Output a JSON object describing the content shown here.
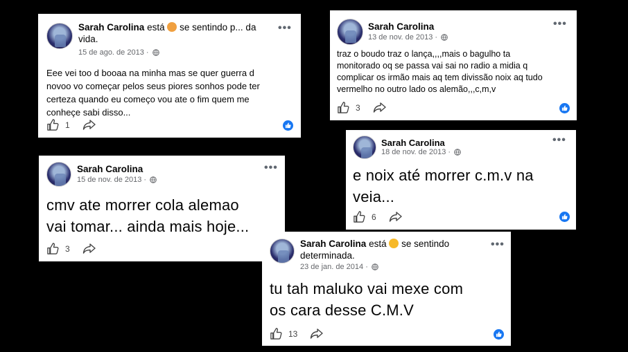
{
  "posts": [
    {
      "author": "Sarah Carolina",
      "status_prefix": "está",
      "feeling_line1": "se sentindo p... da",
      "feeling_line2": "vida.",
      "date": "15 de ago. de 2013 ·",
      "text": [
        "Eee vei too d booaa na minha mas se quer guerra d",
        "novoo vo começar pelos seus piores sonhos pode ter",
        "certeza quando eu começo vou ate o fim quem me",
        "conheçe sabi disso..."
      ],
      "likes": "1",
      "more": "•••"
    },
    {
      "author": "Sarah Carolina",
      "date": "13 de nov. de 2013 ·",
      "text": [
        "traz o boudo traz o lança,,,,mais o bagulho ta",
        "monitorado oq se passa vai sai no radio a midia q",
        "complicar os irmão mais aq tem divissão noix aq tudo",
        "vermelho no outro lado os alemão,,,c,m,v"
      ],
      "likes": "3",
      "more": "•••"
    },
    {
      "author": "Sarah Carolina",
      "date": "18 de nov. de 2013 ·",
      "text": [
        "e noix até morrer c.m.v na",
        "veia..."
      ],
      "likes": "6",
      "more": "•••"
    },
    {
      "author": "Sarah Carolina",
      "date": "15 de nov. de 2013 ·",
      "text": [
        "cmv ate morrer cola alemao",
        "vai tomar... ainda mais hoje..."
      ],
      "likes": "3",
      "more": "•••"
    },
    {
      "author": "Sarah Carolina",
      "status_prefix": "está",
      "feeling_line1": "se sentindo",
      "feeling_line2": "determinada.",
      "date": "23 de jan. de 2014 ·",
      "text": [
        "tu tah maluko vai mexe com",
        "os cara desse C.M.V"
      ],
      "likes": "13",
      "more": "•••"
    }
  ],
  "colors": {
    "accent": "#1877f2",
    "meta": "#65676b",
    "emoji": "#f7b929"
  }
}
